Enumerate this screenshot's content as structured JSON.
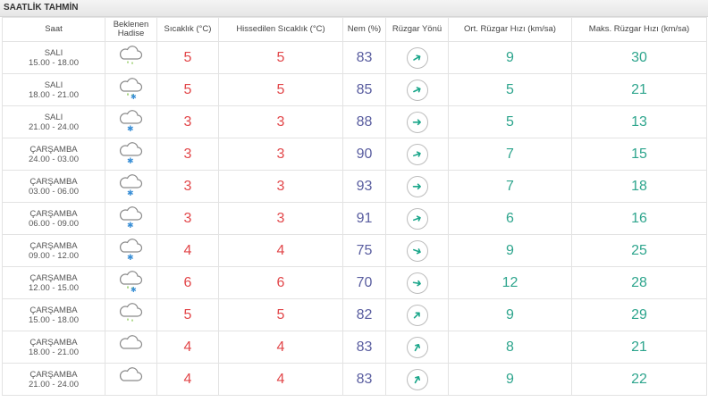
{
  "title": "SAATLİK TAHMİN",
  "headers": {
    "time": "Saat",
    "event": "Beklenen Hadise",
    "temp": "Sıcaklık (°C)",
    "feels": "Hissedilen Sıcaklık (°C)",
    "humidity": "Nem (%)",
    "wind_dir": "Rüzgar Yönü",
    "wind_avg": "Ort. Rüzgar Hızı (km/sa)",
    "wind_max": "Maks. Rüzgar Hızı (km/sa)"
  },
  "colors": {
    "temperature": "#e2474a",
    "humidity": "#5a5ea0",
    "wind": "#2ea58d"
  },
  "rows": [
    {
      "day": "SALI",
      "period": "15.00 - 18.00",
      "icon": "rain-cloud-icon",
      "temp": "5",
      "feels": "5",
      "humidity": "83",
      "wind_dir_deg": 60,
      "wind_avg": "9",
      "wind_max": "30"
    },
    {
      "day": "SALI",
      "period": "18.00 - 21.00",
      "icon": "sleet-cloud-icon",
      "temp": "5",
      "feels": "5",
      "humidity": "85",
      "wind_dir_deg": 65,
      "wind_avg": "5",
      "wind_max": "21"
    },
    {
      "day": "SALI",
      "period": "21.00 - 24.00",
      "icon": "snow-cloud-icon",
      "temp": "3",
      "feels": "3",
      "humidity": "88",
      "wind_dir_deg": 90,
      "wind_avg": "5",
      "wind_max": "13"
    },
    {
      "day": "ÇARŞAMBA",
      "period": "24.00 - 03.00",
      "icon": "snow-cloud-icon",
      "temp": "3",
      "feels": "3",
      "humidity": "90",
      "wind_dir_deg": 70,
      "wind_avg": "7",
      "wind_max": "15"
    },
    {
      "day": "ÇARŞAMBA",
      "period": "03.00 - 06.00",
      "icon": "snow-cloud-icon",
      "temp": "3",
      "feels": "3",
      "humidity": "93",
      "wind_dir_deg": 90,
      "wind_avg": "7",
      "wind_max": "18"
    },
    {
      "day": "ÇARŞAMBA",
      "period": "06.00 - 09.00",
      "icon": "snow-cloud-icon",
      "temp": "3",
      "feels": "3",
      "humidity": "91",
      "wind_dir_deg": 70,
      "wind_avg": "6",
      "wind_max": "16"
    },
    {
      "day": "ÇARŞAMBA",
      "period": "09.00 - 12.00",
      "icon": "snow-cloud-icon",
      "temp": "4",
      "feels": "4",
      "humidity": "75",
      "wind_dir_deg": 110,
      "wind_avg": "9",
      "wind_max": "25"
    },
    {
      "day": "ÇARŞAMBA",
      "period": "12.00 - 15.00",
      "icon": "sleet-cloud-icon",
      "temp": "6",
      "feels": "6",
      "humidity": "70",
      "wind_dir_deg": 100,
      "wind_avg": "12",
      "wind_max": "28"
    },
    {
      "day": "ÇARŞAMBA",
      "period": "15.00 - 18.00",
      "icon": "rain-cloud-icon",
      "temp": "5",
      "feels": "5",
      "humidity": "82",
      "wind_dir_deg": 45,
      "wind_avg": "9",
      "wind_max": "29"
    },
    {
      "day": "ÇARŞAMBA",
      "period": "18.00 - 21.00",
      "icon": "cloud-icon",
      "temp": "4",
      "feels": "4",
      "humidity": "83",
      "wind_dir_deg": 30,
      "wind_avg": "8",
      "wind_max": "21"
    },
    {
      "day": "ÇARŞAMBA",
      "period": "21.00 - 24.00",
      "icon": "cloud-icon",
      "temp": "4",
      "feels": "4",
      "humidity": "83",
      "wind_dir_deg": 30,
      "wind_avg": "9",
      "wind_max": "22"
    }
  ]
}
